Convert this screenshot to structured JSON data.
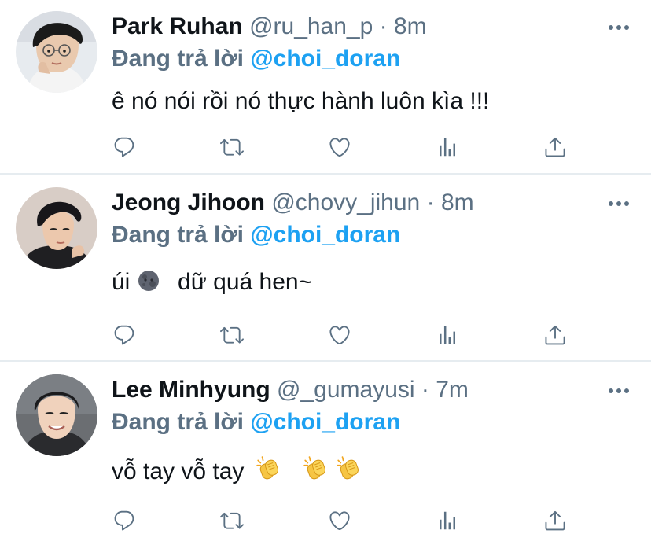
{
  "feed": {
    "colors": {
      "mention": "#1da1f2",
      "secondary": "#5b7083",
      "primary": "#0f1419",
      "divider": "#e6ecf0"
    },
    "tweets": [
      {
        "name": "Park Ruhan",
        "handle": "@ru_han_p",
        "dot": "·",
        "time": "8m",
        "reply_label": "Đang trả lời",
        "mention": "@choi_doran",
        "text": "ê nó nói rồi nó thực hành luôn kìa !!!"
      },
      {
        "name": "Jeong Jihoon",
        "handle": "@chovy_jihun",
        "dot": "·",
        "time": "8m",
        "reply_label": "Đang trả lời",
        "mention": "@choi_doran",
        "text_before": "úi",
        "emoji": "new-moon-face",
        "text_after": "dữ quá hen~"
      },
      {
        "name": "Lee Minhyung",
        "handle": "@_gumayusi",
        "dot": "·",
        "time": "7m",
        "reply_label": "Đang trả lời",
        "mention": "@choi_doran",
        "text": "vỗ tay vỗ tay",
        "emoji": [
          "clapping-hands",
          "clapping-hands",
          "clapping-hands"
        ]
      }
    ],
    "action_icons": [
      "reply-icon",
      "retweet-icon",
      "like-icon",
      "analytics-icon",
      "share-icon"
    ],
    "more_icon": "more-options-icon"
  }
}
